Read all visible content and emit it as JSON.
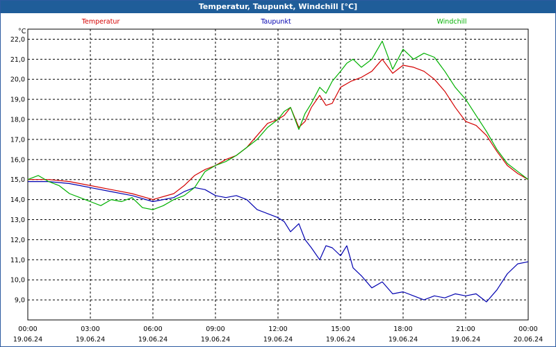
{
  "window": {
    "title": "Temperatur, Taupunkt, Windchill [°C]"
  },
  "colors": {
    "titlebar": "#1f5d99",
    "temperatur": "#d40000",
    "taupunkt": "#0000b0",
    "windchill": "#00b000",
    "grid": "#000000"
  },
  "chart_data": {
    "type": "line",
    "title": "Temperatur, Taupunkt, Windchill [°C]",
    "ylabel": "°C",
    "ylim": [
      8.0,
      22.5
    ],
    "xlim_hours": [
      0,
      24
    ],
    "grid": true,
    "legend_placement": "top",
    "y_ticks": [
      "9,0",
      "10,0",
      "11,0",
      "12,0",
      "13,0",
      "14,0",
      "15,0",
      "16,0",
      "17,0",
      "18,0",
      "19,0",
      "20,0",
      "21,0",
      "22,0"
    ],
    "x_ticks": [
      {
        "time": "00:00",
        "date": "19.06.24"
      },
      {
        "time": "03:00",
        "date": "19.06.24"
      },
      {
        "time": "06:00",
        "date": "19.06.24"
      },
      {
        "time": "09:00",
        "date": "19.06.24"
      },
      {
        "time": "12:00",
        "date": "19.06.24"
      },
      {
        "time": "15:00",
        "date": "19.06.24"
      },
      {
        "time": "18:00",
        "date": "19.06.24"
      },
      {
        "time": "21:00",
        "date": "19.06.24"
      },
      {
        "time": "00:00",
        "date": "20.06.24"
      }
    ],
    "series": [
      {
        "name": "Temperatur",
        "color": "#d40000",
        "x": [
          0,
          1,
          2,
          3,
          4,
          5,
          6,
          7,
          7.5,
          8,
          8.5,
          9,
          9.5,
          10,
          10.5,
          11,
          11.5,
          12,
          12.3,
          12.6,
          13,
          13.3,
          13.6,
          14,
          14.3,
          14.6,
          15,
          15.5,
          16,
          16.5,
          17,
          17.5,
          18,
          18.5,
          19,
          19.5,
          20,
          20.5,
          21,
          21.5,
          22,
          22.5,
          23,
          23.5,
          24
        ],
        "y": [
          15.0,
          15.0,
          14.9,
          14.7,
          14.5,
          14.3,
          14.0,
          14.3,
          14.7,
          15.2,
          15.5,
          15.7,
          16.0,
          16.2,
          16.6,
          17.2,
          17.8,
          18.0,
          18.2,
          18.6,
          17.6,
          17.9,
          18.6,
          19.2,
          18.7,
          18.8,
          19.6,
          19.9,
          20.1,
          20.4,
          21.0,
          20.3,
          20.7,
          20.6,
          20.4,
          20.0,
          19.4,
          18.6,
          17.9,
          17.7,
          17.2,
          16.4,
          15.7,
          15.3,
          15.0
        ]
      },
      {
        "name": "Taupunkt",
        "color": "#0000b0",
        "x": [
          0,
          1,
          2,
          3,
          4,
          5,
          6,
          7,
          7.5,
          8,
          8.5,
          9,
          9.5,
          10,
          10.5,
          11,
          11.5,
          12,
          12.3,
          12.6,
          13,
          13.3,
          13.6,
          14,
          14.3,
          14.6,
          15,
          15.3,
          15.6,
          16,
          16.5,
          17,
          17.5,
          18,
          18.5,
          19,
          19.5,
          20,
          20.5,
          21,
          21.5,
          22,
          22.5,
          23,
          23.5,
          24
        ],
        "y": [
          14.9,
          14.9,
          14.8,
          14.6,
          14.4,
          14.2,
          13.9,
          14.1,
          14.4,
          14.6,
          14.5,
          14.2,
          14.1,
          14.2,
          14.0,
          13.5,
          13.3,
          13.1,
          12.9,
          12.4,
          12.8,
          12.0,
          11.6,
          11.0,
          11.7,
          11.6,
          11.2,
          11.7,
          10.6,
          10.2,
          9.6,
          9.9,
          9.3,
          9.4,
          9.2,
          9.0,
          9.2,
          9.1,
          9.3,
          9.2,
          9.3,
          8.9,
          9.5,
          10.3,
          10.8,
          10.9
        ]
      },
      {
        "name": "Windchill",
        "color": "#00b000",
        "x": [
          0,
          0.5,
          1,
          1.5,
          2,
          2.5,
          3,
          3.5,
          4,
          4.5,
          5,
          5.5,
          6,
          6.5,
          7,
          7.5,
          8,
          8.5,
          9,
          9.5,
          10,
          10.5,
          11,
          11.5,
          12,
          12.3,
          12.6,
          13,
          13.3,
          13.6,
          14,
          14.3,
          14.6,
          15,
          15.3,
          15.6,
          16,
          16.5,
          17,
          17.5,
          18,
          18.5,
          19,
          19.5,
          20,
          20.5,
          21,
          21.5,
          22,
          22.5,
          23,
          23.5,
          24
        ],
        "y": [
          15.0,
          15.2,
          14.9,
          14.7,
          14.3,
          14.1,
          13.9,
          13.7,
          14.0,
          13.9,
          14.1,
          13.6,
          13.5,
          13.7,
          14.0,
          14.2,
          14.6,
          15.4,
          15.7,
          15.9,
          16.2,
          16.6,
          17.0,
          17.6,
          18.0,
          18.4,
          18.6,
          17.5,
          18.3,
          18.8,
          19.6,
          19.3,
          19.9,
          20.4,
          20.8,
          21.0,
          20.6,
          21.0,
          21.9,
          20.5,
          21.5,
          21.0,
          21.3,
          21.1,
          20.4,
          19.6,
          19.0,
          18.2,
          17.4,
          16.5,
          15.8,
          15.4,
          15.0
        ]
      }
    ]
  }
}
